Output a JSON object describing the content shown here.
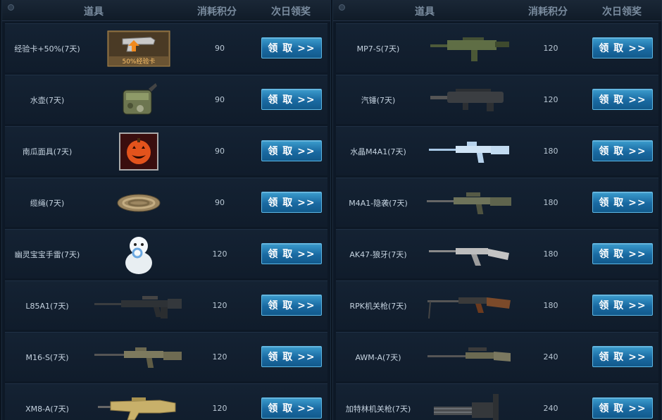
{
  "headers": {
    "item": "道具",
    "cost": "消耗积分",
    "reward": "次日领奖"
  },
  "claim_label": "领 取 >>",
  "exp_card_label": "50%经验卡",
  "left": [
    {
      "name": "经验卡+50%(7天)",
      "cost": "90",
      "icon": "exp-card-icon"
    },
    {
      "name": "水壶(7天)",
      "cost": "90",
      "icon": "canteen-icon"
    },
    {
      "name": "南瓜面具(7天)",
      "cost": "90",
      "icon": "pumpkin-mask-icon"
    },
    {
      "name": "缆绳(7天)",
      "cost": "90",
      "icon": "rope-icon"
    },
    {
      "name": "幽灵宝宝手雷(7天)",
      "cost": "120",
      "icon": "ghost-grenade-icon"
    },
    {
      "name": "L85A1(7天)",
      "cost": "120",
      "icon": "rifle-icon"
    },
    {
      "name": "M16-S(7天)",
      "cost": "120",
      "icon": "rifle-icon"
    },
    {
      "name": "XM8-A(7天)",
      "cost": "120",
      "icon": "rifle-icon"
    }
  ],
  "right": [
    {
      "name": "MP7-S(7天)",
      "cost": "120",
      "icon": "smg-icon"
    },
    {
      "name": "汽锤(7天)",
      "cost": "120",
      "icon": "shotgun-icon"
    },
    {
      "name": "水晶M4A1(7天)",
      "cost": "180",
      "icon": "rifle-icon"
    },
    {
      "name": "M4A1-隐袭(7天)",
      "cost": "180",
      "icon": "rifle-icon"
    },
    {
      "name": "AK47-狼牙(7天)",
      "cost": "180",
      "icon": "rifle-icon"
    },
    {
      "name": "RPK机关枪(7天)",
      "cost": "180",
      "icon": "machine-gun-icon"
    },
    {
      "name": "AWM-A(7天)",
      "cost": "240",
      "icon": "sniper-rifle-icon"
    },
    {
      "name": "加特林机关枪(7天)",
      "cost": "240",
      "icon": "gatling-gun-icon"
    }
  ],
  "colors": {
    "button_top": "#3b9ccd",
    "button_bottom": "#125a8c",
    "panel_bg": "#0d1826",
    "header_text": "#7a8c9f"
  }
}
